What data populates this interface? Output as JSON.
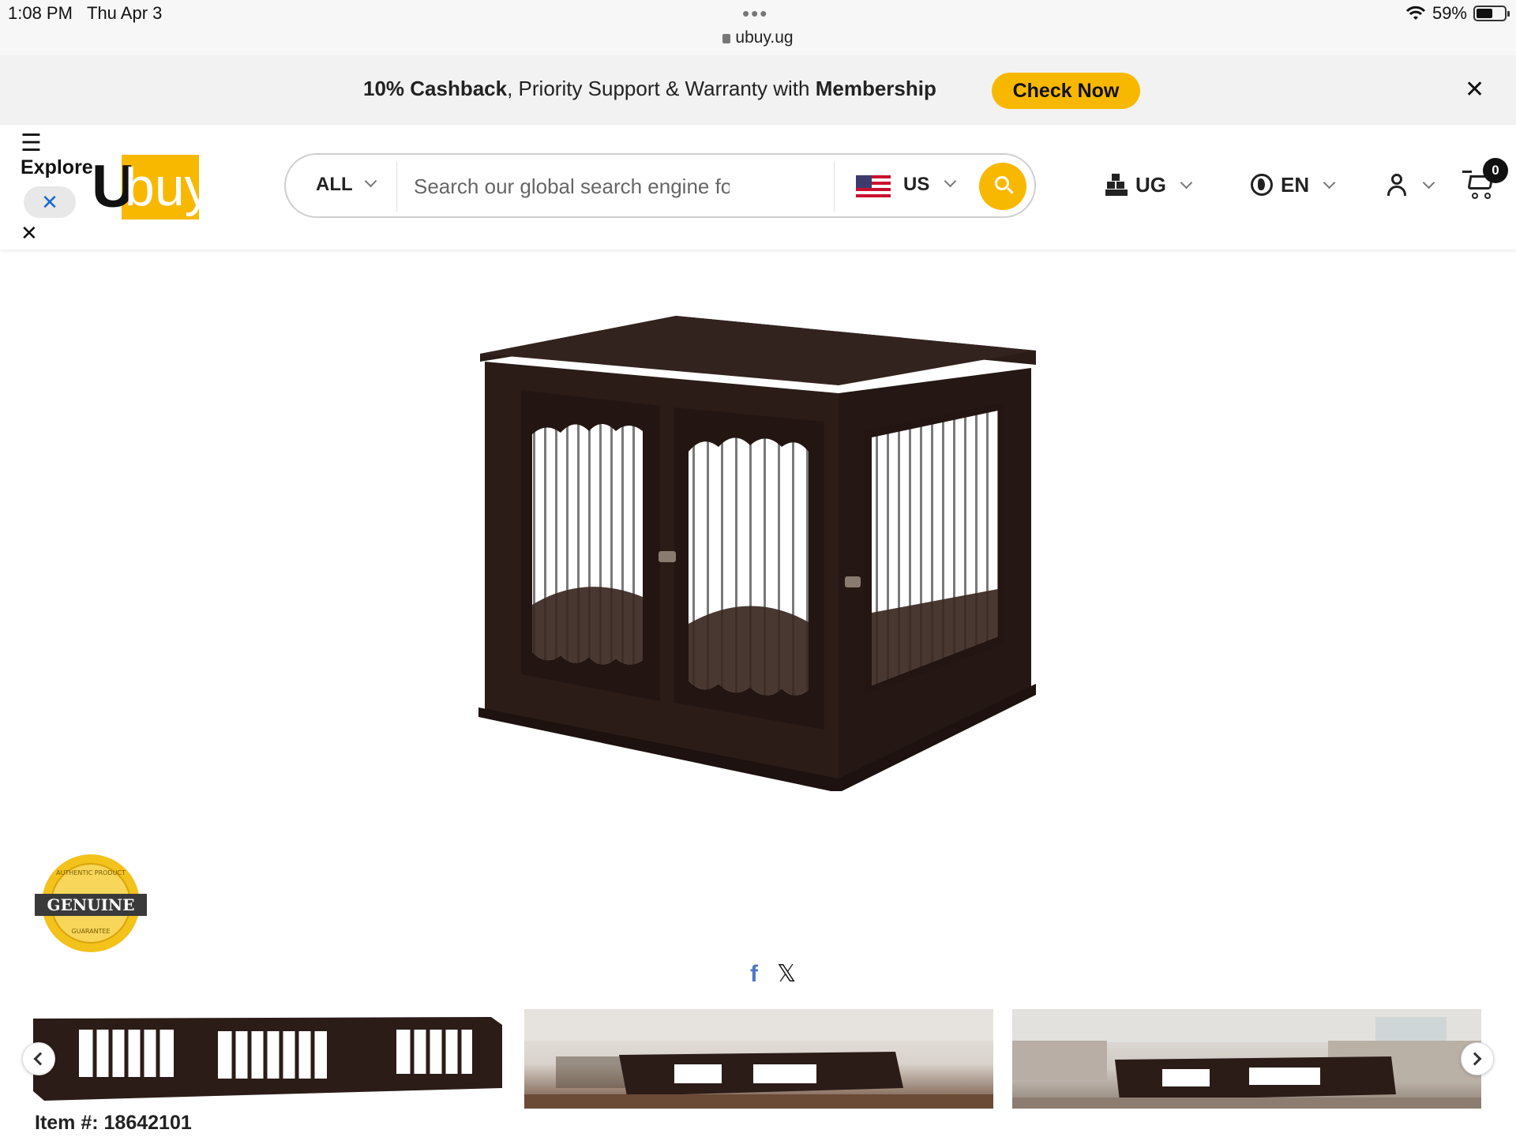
{
  "status_bar": {
    "time": "1:08 PM",
    "date": "Thu Apr 3",
    "url": "ubuy.ug",
    "battery": "59%",
    "battery_level": 0.59
  },
  "promo": {
    "cashback": "10% Cashback",
    "middle": ", Priority Support & Warranty with ",
    "membership": "Membership",
    "cta": "Check Now",
    "close_icon": "close-icon"
  },
  "header": {
    "explore_label": "Explore",
    "logo_u": "U",
    "logo_buy": "buy",
    "search": {
      "category": "ALL",
      "placeholder": "Search our global search engine for prod",
      "store": "US"
    },
    "country": "UG",
    "language": "EN",
    "cart_count": "0"
  },
  "product": {
    "image_alt": "Espresso wooden dog crate end table",
    "badge_label": "GENUINE",
    "badge_top": "AUTHENTIC PRODUCT",
    "badge_bottom": "GUARANTEE",
    "item_number": "Item #: 18642101"
  },
  "share": {
    "facebook": "f",
    "x": "𝕏"
  },
  "colors": {
    "accent": "#f9b800",
    "crate": "#2b1c18",
    "badge_gold": "#f3c21b"
  }
}
